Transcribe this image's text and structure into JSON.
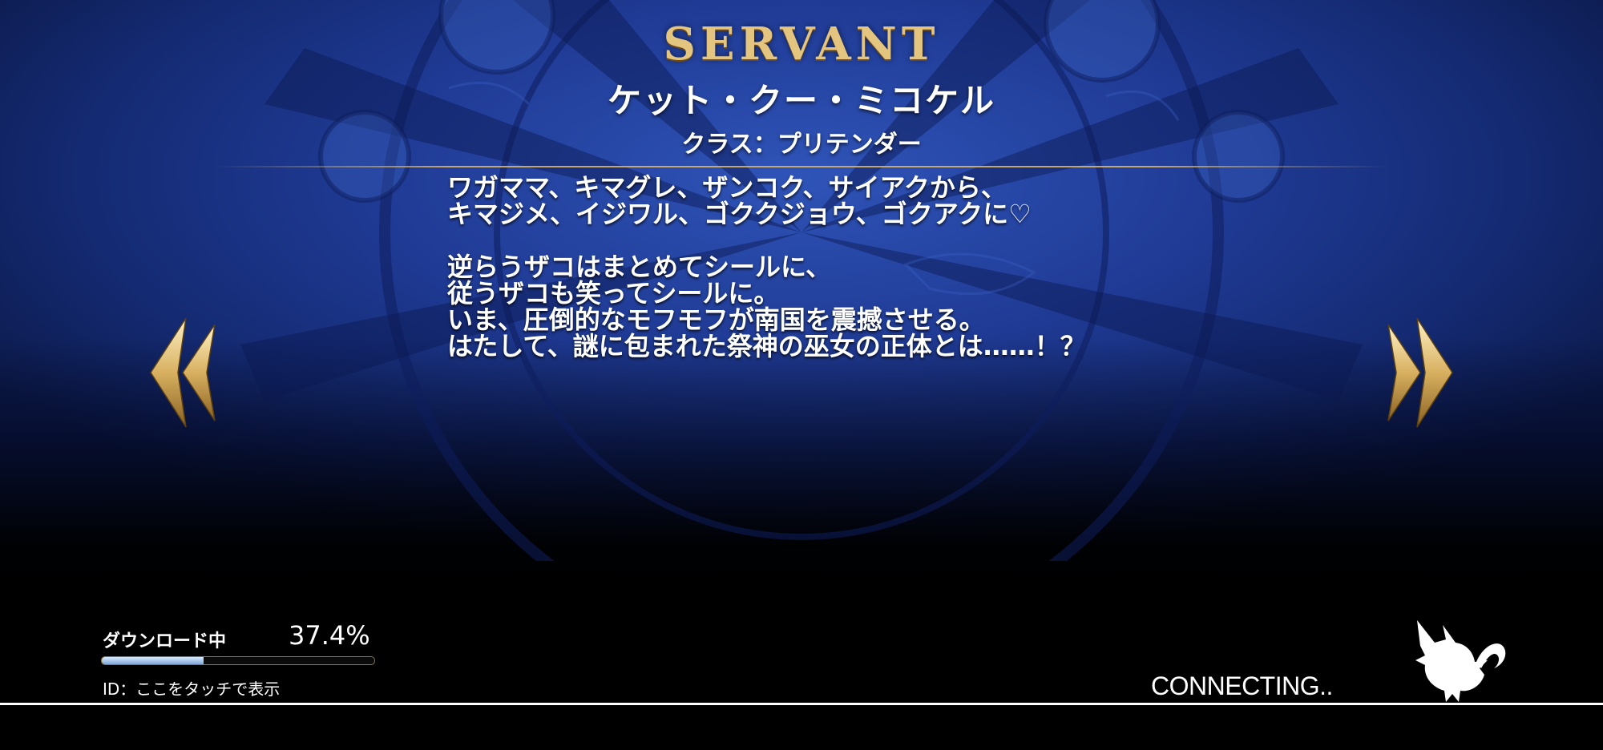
{
  "header": {
    "section_title": "SERVANT",
    "servant_name": "ケット・クー・ミコケル",
    "class_label": "クラス：プリテンダー"
  },
  "description": {
    "paragraph1": [
      "ワガママ、キマグレ、ザンコク、サイアクから、",
      "キマジメ、イジワル、ゴククジョウ、ゴクアクに♡"
    ],
    "paragraph2": [
      "逆らうザコはまとめてシールに、",
      "従うザコも笑ってシールに。",
      "いま、圧倒的なモフモフが南国を震撼させる。",
      "はたして、謎に包まれた祭神の巫女の正体とは……！？"
    ]
  },
  "navigation": {
    "prev_icon": "double-chevron-left-icon",
    "next_icon": "double-chevron-right-icon"
  },
  "download": {
    "label": "ダウンロード中",
    "percent_text": "37.4%",
    "progress": 0.374
  },
  "footer": {
    "id_touch_text": "ID：ここをタッチで表示",
    "connecting_text": "CONNECTING..",
    "loading_icon": "fou-silhouette-icon"
  },
  "colors": {
    "background_blue": "#1f3a94",
    "gold": "#e3c580",
    "progress_fill": "#a9c8ee"
  }
}
